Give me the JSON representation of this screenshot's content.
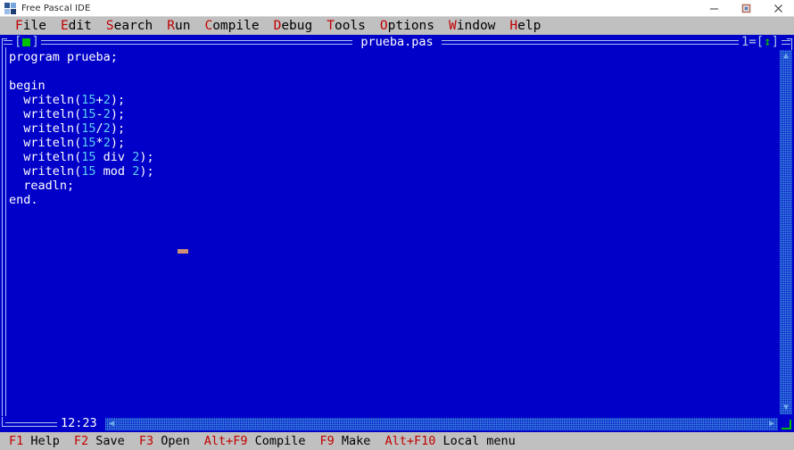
{
  "window": {
    "title": "Free Pascal IDE",
    "icon": "app-icon",
    "controls": [
      {
        "name": "minimize",
        "glyph": "minimize-icon"
      },
      {
        "name": "maximize",
        "glyph": "maximize-icon"
      },
      {
        "name": "close",
        "glyph": "close-icon"
      }
    ]
  },
  "menubar": {
    "items": [
      {
        "hotkey": "F",
        "rest": "ile"
      },
      {
        "hotkey": "E",
        "rest": "dit"
      },
      {
        "hotkey": "S",
        "rest": "earch"
      },
      {
        "hotkey": "R",
        "rest": "un"
      },
      {
        "hotkey": "C",
        "rest": "ompile"
      },
      {
        "hotkey": "D",
        "rest": "ebug"
      },
      {
        "hotkey": "T",
        "rest": "ools"
      },
      {
        "hotkey": "O",
        "rest": "ptions"
      },
      {
        "hotkey": "W",
        "rest": "indow"
      },
      {
        "hotkey": "H",
        "rest": "elp"
      }
    ]
  },
  "editor": {
    "title": "prueba.pas",
    "window_number": "1",
    "close_box_left": "[",
    "close_box_right": "]",
    "zoom_box_left": "=[",
    "zoom_box_right": "]",
    "zoom_glyph": "↕",
    "cursor_position": "12:23",
    "scroll": {
      "up_arrow": "▲",
      "down_arrow": "▼",
      "left_arrow": "◀",
      "right_arrow": "▶"
    },
    "code_lines": [
      [
        {
          "t": "program prueba;",
          "c": "plain"
        }
      ],
      [],
      [
        {
          "t": "begin",
          "c": "plain"
        }
      ],
      [
        {
          "t": "  writeln(",
          "c": "plain"
        },
        {
          "t": "15",
          "c": "num"
        },
        {
          "t": "+",
          "c": "plain"
        },
        {
          "t": "2",
          "c": "num"
        },
        {
          "t": ");",
          "c": "plain"
        }
      ],
      [
        {
          "t": "  writeln(",
          "c": "plain"
        },
        {
          "t": "15",
          "c": "num"
        },
        {
          "t": "-",
          "c": "plain"
        },
        {
          "t": "2",
          "c": "num"
        },
        {
          "t": ");",
          "c": "plain"
        }
      ],
      [
        {
          "t": "  writeln(",
          "c": "plain"
        },
        {
          "t": "15",
          "c": "num"
        },
        {
          "t": "/",
          "c": "plain"
        },
        {
          "t": "2",
          "c": "num"
        },
        {
          "t": ");",
          "c": "plain"
        }
      ],
      [
        {
          "t": "  writeln(",
          "c": "plain"
        },
        {
          "t": "15",
          "c": "num"
        },
        {
          "t": "*",
          "c": "plain"
        },
        {
          "t": "2",
          "c": "num"
        },
        {
          "t": ");",
          "c": "plain"
        }
      ],
      [
        {
          "t": "  writeln(",
          "c": "plain"
        },
        {
          "t": "15",
          "c": "num"
        },
        {
          "t": " div ",
          "c": "plain"
        },
        {
          "t": "2",
          "c": "num"
        },
        {
          "t": ");",
          "c": "plain"
        }
      ],
      [
        {
          "t": "  writeln(",
          "c": "plain"
        },
        {
          "t": "15",
          "c": "num"
        },
        {
          "t": " mod ",
          "c": "plain"
        },
        {
          "t": "2",
          "c": "num"
        },
        {
          "t": ");",
          "c": "plain"
        }
      ],
      [
        {
          "t": "  readln;",
          "c": "plain"
        }
      ],
      [
        {
          "t": "end.",
          "c": "plain"
        }
      ]
    ]
  },
  "statusbar": {
    "keys": [
      {
        "key": "F1",
        "label": "Help"
      },
      {
        "key": "F2",
        "label": "Save"
      },
      {
        "key": "F3",
        "label": "Open"
      },
      {
        "key": "Alt+F9",
        "label": "Compile"
      },
      {
        "key": "F9",
        "label": "Make"
      },
      {
        "key": "Alt+F10",
        "label": "Local menu"
      }
    ]
  },
  "colors": {
    "desktop_blue": "#0000c8",
    "menu_gray": "#c0c0c0",
    "hotkey_red": "#c00000",
    "frame_light": "#a8c8f0",
    "number_cyan": "#5bd0f0",
    "green_accent": "#00c000",
    "cursor_tan": "#cf8f74"
  }
}
